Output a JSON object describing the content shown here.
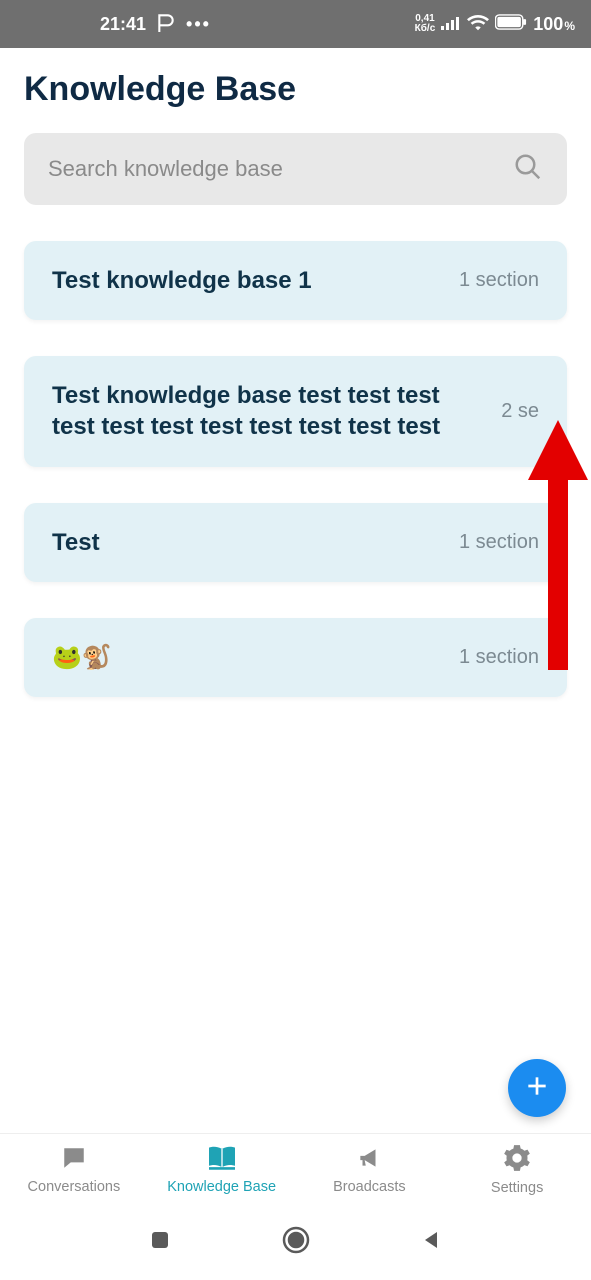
{
  "status_bar": {
    "time": "21:41",
    "net_rate_top": "0,41",
    "net_rate_bottom": "Кб/с",
    "battery": "100",
    "battery_unit": "%"
  },
  "header": {
    "title": "Knowledge Base"
  },
  "search": {
    "placeholder": "Search knowledge base"
  },
  "items": [
    {
      "title": "Test knowledge base 1",
      "meta": "1 section"
    },
    {
      "title": "Test knowledge base test test test test test test test test test test test",
      "meta": "2 se"
    },
    {
      "title": "Test",
      "meta": "1 section"
    },
    {
      "title": "🐸🐒",
      "meta": "1 section"
    }
  ],
  "nav": {
    "conversations": "Conversations",
    "knowledge_base": "Knowledge Base",
    "broadcasts": "Broadcasts",
    "settings": "Settings"
  }
}
